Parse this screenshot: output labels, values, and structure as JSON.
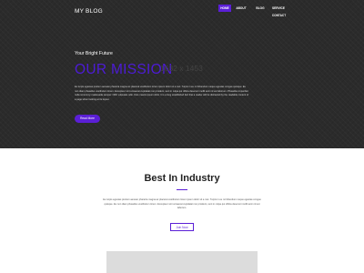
{
  "header": {
    "brand": "MY BLOG",
    "nav": [
      {
        "label": "HOME",
        "active": true
      },
      {
        "label": "ABOUT",
        "active": false
      },
      {
        "label": "BLOG",
        "active": false
      },
      {
        "label": "SERVICE",
        "active": false
      },
      {
        "label": "CONTACT",
        "active": false
      }
    ]
  },
  "hero": {
    "kicker": "Your Bright Future",
    "title": "OUR MISSION",
    "image_dims": "1632 x 1453",
    "body": "Eu turpis egestas pretium aenean pharetra magna ac placerat vestibulum lorem ipsum dolor sit a met. Turpis in eu mi bibendum neque egestas congue quisque. Eu non diam phasellus vestibulum lorem. Excepteur sint occaecat cupidatat non proident, sunt in culpa qui officia deserunt mollit anim id est laborum. Phasellus imperdiet nulla nonummy malesuada semper. Nibh vulputate odio. Duis mauris ipsum dolor. It is a long established fact that a reader will be distracted by the readable content of a page when looking at its layout.",
    "button_label": "Read More"
  },
  "section": {
    "title": "Best In Industry",
    "body": "Eu turpis egestas pretium aenean pharetra magna ac placerat vestibulum lorem ipsum dolor sit a met. Turpis in eu mi bibendum neque egestas congue quisque. Eu non diam phasellus vestibulum lorem. Excepteur sint occaecat cupidatat non proident, sunt in culpa qui officia deserunt mollit anim id est laborum.",
    "button_label": "Join Now"
  },
  "colors": {
    "accent": "#5b1fd6",
    "hero_bg": "#2b2b2b"
  }
}
